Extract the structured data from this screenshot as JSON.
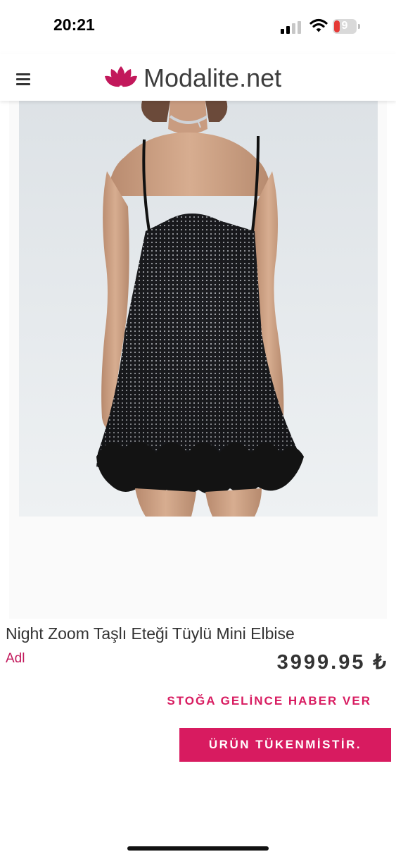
{
  "status_bar": {
    "time": "20:21",
    "battery_level": "9"
  },
  "header": {
    "logo_text": "Modalite.net"
  },
  "product": {
    "title": "Night Zoom Taşlı Eteği Tüylü Mini Elbise",
    "brand": "Adl",
    "price": "3999.95 ₺",
    "notify_label": "STOĞA GELİNCE HABER VER",
    "soldout_label": "ÜRÜN TÜKENMİSTİR."
  },
  "icons": {
    "menu": "hamburger-menu-icon",
    "logo": "lotus-logo-icon",
    "signal": "cellular-signal-icon",
    "wifi": "wifi-icon",
    "battery": "battery-icon"
  },
  "colors": {
    "accent": "#d81b60",
    "brand_link": "#c2185b",
    "logo_icon": "#c2185b"
  }
}
